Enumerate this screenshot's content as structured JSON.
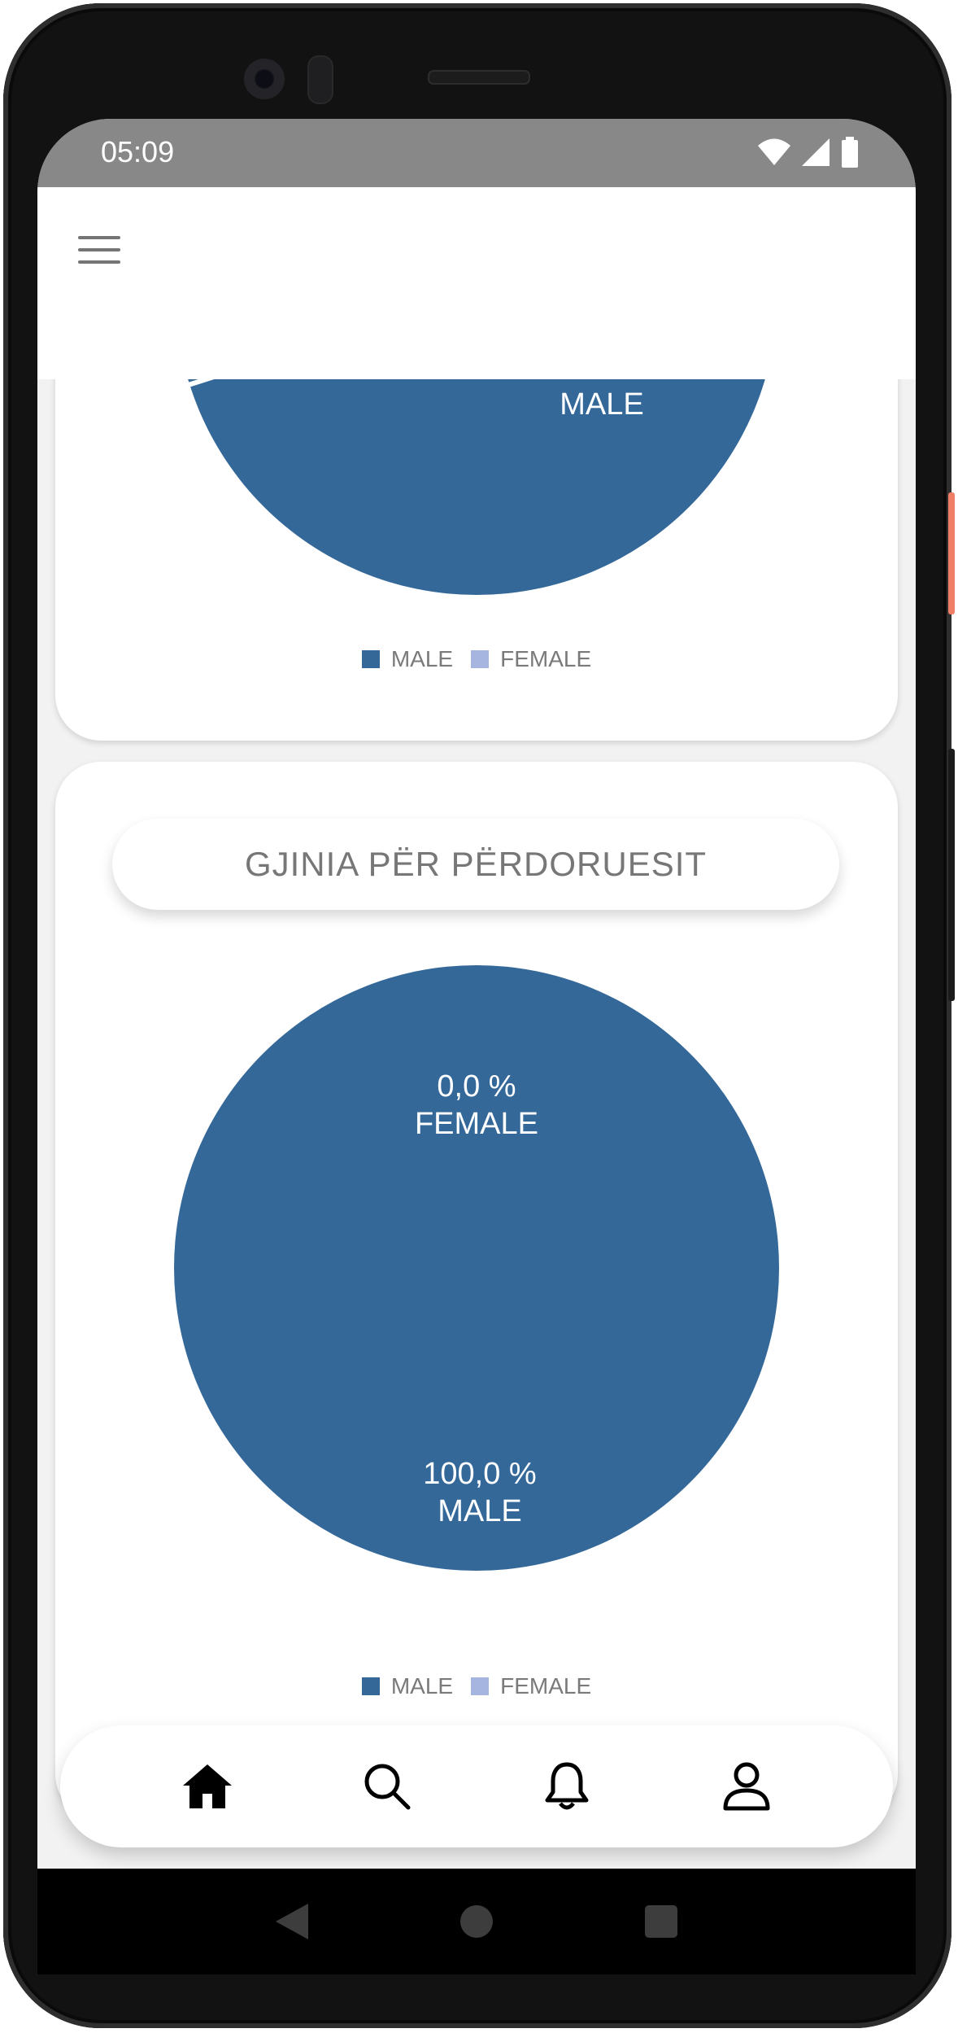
{
  "status_bar": {
    "time": "05:09",
    "icons": [
      "wifi-icon",
      "signal-icon",
      "battery-icon"
    ]
  },
  "app_bar": {
    "menu_icon": "hamburger-menu-icon"
  },
  "charts": [
    {
      "legend": [
        {
          "label": "MALE",
          "color": "#346899"
        },
        {
          "label": "FEMALE",
          "color": "#a6b5e0"
        }
      ],
      "visible_slice_label": "MALE"
    },
    {
      "title": "GJINIA PËR PËRDORUESIT",
      "labels": {
        "female_value": "0,0 %",
        "female_name": "FEMALE",
        "male_value": "100,0 %",
        "male_name": "MALE"
      },
      "legend": [
        {
          "label": "MALE",
          "color": "#346899"
        },
        {
          "label": "FEMALE",
          "color": "#a6b5e0"
        }
      ]
    }
  ],
  "chart_data": [
    {
      "type": "pie",
      "categories": [
        "MALE",
        "FEMALE"
      ],
      "values": [
        100.0,
        0.0
      ],
      "title": "",
      "legend_placement": "bottom"
    },
    {
      "type": "pie",
      "categories": [
        "MALE",
        "FEMALE"
      ],
      "values": [
        100.0,
        0.0
      ],
      "title": "GJINIA PËR PËRDORUESIT",
      "legend_placement": "bottom"
    }
  ],
  "bottom_nav": {
    "items": [
      {
        "icon": "home-icon",
        "active": true
      },
      {
        "icon": "search-icon",
        "active": false
      },
      {
        "icon": "bell-icon",
        "active": false
      },
      {
        "icon": "profile-icon",
        "active": false
      }
    ]
  },
  "system_nav": {
    "icons": [
      "back-icon",
      "home-circle-icon",
      "recents-icon"
    ]
  },
  "colors": {
    "male": "#346899",
    "female": "#a6b5e0",
    "status_bar": "#888888"
  }
}
